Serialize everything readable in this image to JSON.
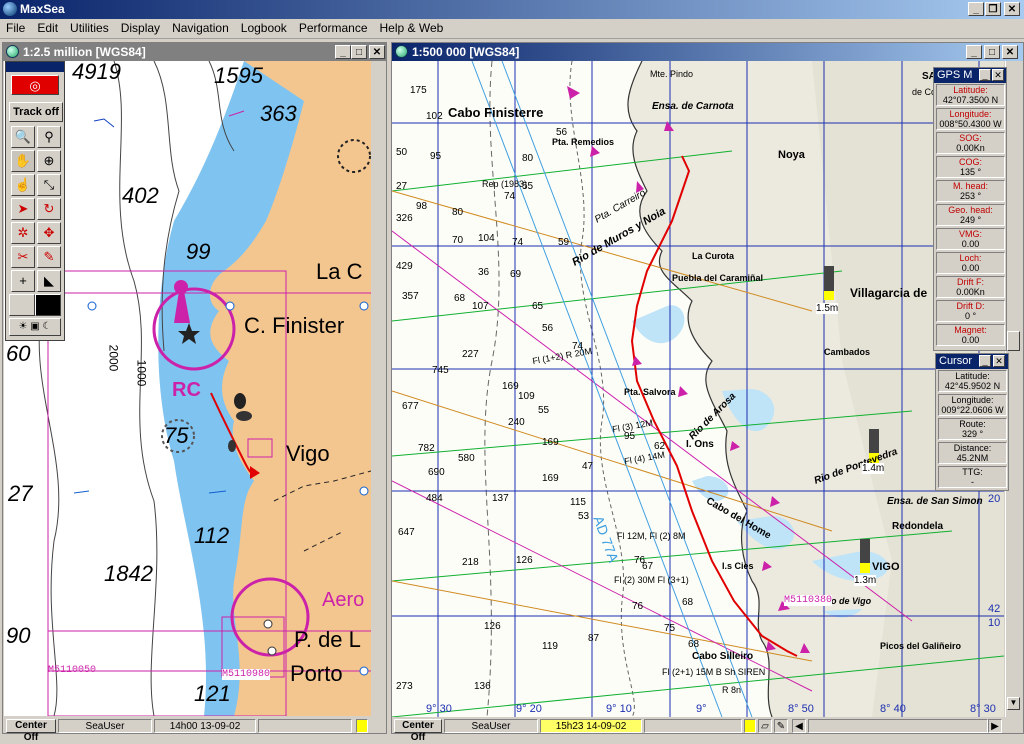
{
  "app": {
    "title": "MaxSea"
  },
  "menu": [
    "File",
    "Edit",
    "Utilities",
    "Display",
    "Navigation",
    "Logbook",
    "Performance",
    "Help & Web"
  ],
  "left_window": {
    "title": "1:2.5 million [WGS84]",
    "toolbox": {
      "track_label": "Track off"
    },
    "chart_labels": {
      "depths": [
        "4919",
        "1595",
        "363",
        "402",
        "99",
        "60",
        "2000",
        "1000",
        "75",
        "27",
        "112",
        "1842",
        "90",
        "121"
      ],
      "places": [
        "C. Finister",
        "La C",
        "Vigo",
        "Porto",
        "P. de L",
        "Aero"
      ],
      "rc": "RC",
      "cells": [
        "M5110050",
        "M5110980"
      ]
    },
    "status": {
      "center_btn": "Center Off",
      "user": "SeaUser",
      "time": "14h00  13-09-02"
    }
  },
  "right_window": {
    "title": "1:500 000 [WGS84]",
    "chart_labels": {
      "places": [
        "Cabo Finisterre",
        "Pta. Remedios",
        "Ensa. de Carnota",
        "Mte. Pindo",
        "Noya",
        "Pta. Carreiro",
        "Rio de Muros y Noia",
        "Puebla del Caramiñal",
        "La Curota",
        "Villagarcia de",
        "Cambados",
        "Pta. Salvora",
        "Rio de Arosa",
        "I. Ons",
        "Cabo del Home",
        "VIGO",
        "Redondela",
        "Cabo Silleiro",
        "Ensa. de San Simon",
        "Picos del Galiñeiro",
        "SANTIAGO",
        "de Compos",
        "I.s Cies",
        "Rio de Pontevedra",
        "Rio de Vigo"
      ],
      "depths": [
        "175",
        "102",
        "50",
        "95",
        "27",
        "326",
        "98",
        "80",
        "74",
        "70",
        "80",
        "55",
        "56",
        "104",
        "429",
        "357",
        "107",
        "227",
        "745",
        "677",
        "782",
        "690",
        "647",
        "484",
        "580",
        "240",
        "169",
        "109",
        "137",
        "218",
        "126",
        "136",
        "273",
        "55",
        "169",
        "169",
        "95",
        "62",
        "47",
        "53",
        "87",
        "76",
        "126",
        "115",
        "67",
        "76",
        "75",
        "68",
        "68",
        "119",
        "65",
        "74",
        "59",
        "36",
        "56",
        "74",
        "69",
        "68"
      ],
      "grid": [
        "9° 30",
        "9° 20",
        "9° 10",
        "9°",
        "8° 50",
        "8° 40",
        "8° 30"
      ],
      "lat_marks": [
        "20",
        "42",
        "10"
      ],
      "lights": [
        "Fl (1+2) R 20M",
        "Fl (3) 12M",
        "Fl (4) 14M",
        "Fl 12M, Fl (2) 8M",
        "Fl (2) 30M Fl (3+1)",
        "Fl (2+1) 15M B Sh SIREN",
        "R 8n"
      ],
      "route_code": "AD 77A",
      "rep": "Rep (1983)",
      "cell": "M5110380",
      "tide_labels": [
        "1.5m",
        "1.4m",
        "1.3m"
      ]
    },
    "status": {
      "center_btn": "Center Off",
      "user": "SeaUser",
      "time": "15h23  14-09-02"
    }
  },
  "gps_panel": {
    "title": "GPS M",
    "fields": [
      {
        "label": "Latitude:",
        "value": "42°07.3500 N"
      },
      {
        "label": "Longitude:",
        "value": "008°50.4300 W"
      },
      {
        "label": "SOG:",
        "value": "0.00Kn"
      },
      {
        "label": "COG:",
        "value": "135 °"
      },
      {
        "label": "M. head:",
        "value": "253 °"
      },
      {
        "label": "Geo. head:",
        "value": "249 °"
      },
      {
        "label": "VMG:",
        "value": "0.00"
      },
      {
        "label": "Loch:",
        "value": "0.00"
      },
      {
        "label": "Drift F:",
        "value": "0.00Kn"
      },
      {
        "label": "Drift D:",
        "value": "0 °"
      },
      {
        "label": "Magnet:",
        "value": "0.00"
      }
    ]
  },
  "cursor_panel": {
    "title": "Cursor",
    "fields": [
      {
        "label": "Latitude:",
        "value": "42°45.9502 N"
      },
      {
        "label": "Longitude:",
        "value": "009°22.0606 W"
      },
      {
        "label": "Route:",
        "value": "329 °"
      },
      {
        "label": "Distance:",
        "value": "45.2NM"
      },
      {
        "label": "TTG:",
        "value": "-"
      }
    ]
  },
  "colors": {
    "titlebar_active": "#0a246a",
    "sea": "#7fc3f0",
    "land": "#f3c690",
    "track": "#e00000",
    "magenta": "#cc22aa"
  }
}
